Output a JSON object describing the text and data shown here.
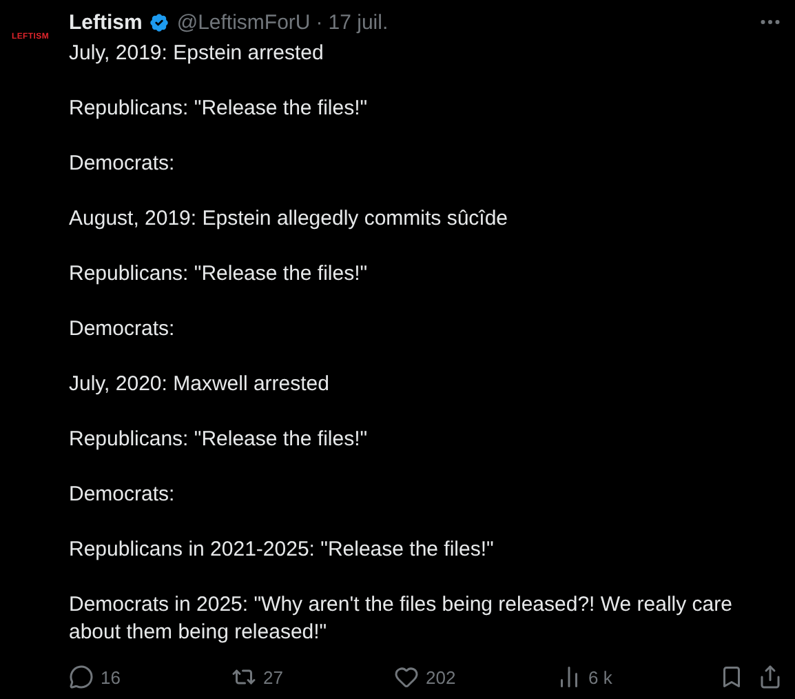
{
  "avatar": {
    "text": "LEFTISM"
  },
  "author": {
    "name": "Leftism",
    "verified": true,
    "handle": "@LeftismForU",
    "separator": "·",
    "date": "17 juil."
  },
  "paragraphs": [
    "July, 2019: Epstein arrested",
    "Republicans: \"Release the files!\"",
    "Democrats:",
    "August, 2019: Epstein allegedly commits sûcîde",
    "Republicans: \"Release the files!\"",
    "Democrats:",
    "July, 2020: Maxwell arrested",
    "Republicans: \"Release the files!\"",
    "Democrats:",
    "Republicans in 2021-2025: \"Release the files!\"",
    "Democrats in 2025: \"Why aren't the files being released?! We really care about them being released!\""
  ],
  "actions": [
    {
      "kind": "reply",
      "count": "16"
    },
    {
      "kind": "retweet",
      "count": "27"
    },
    {
      "kind": "like",
      "count": "202"
    },
    {
      "kind": "views",
      "count": "6 k"
    }
  ]
}
